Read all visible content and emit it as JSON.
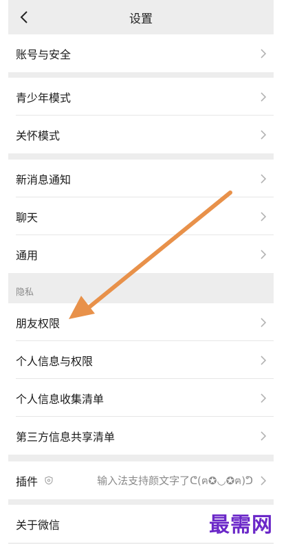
{
  "header": {
    "title": "设置",
    "back_icon": "chevron-left-icon"
  },
  "groups": [
    {
      "items": [
        {
          "label": "账号与安全"
        }
      ]
    },
    {
      "items": [
        {
          "label": "青少年模式"
        },
        {
          "label": "关怀模式"
        }
      ]
    },
    {
      "items": [
        {
          "label": "新消息通知"
        },
        {
          "label": "聊天"
        },
        {
          "label": "通用"
        }
      ]
    }
  ],
  "privacy": {
    "section_label": "隐私",
    "items": [
      {
        "label": "朋友权限"
      },
      {
        "label": "个人信息与权限"
      },
      {
        "label": "个人信息收集清单"
      },
      {
        "label": "第三方信息共享清单"
      }
    ]
  },
  "plugins": {
    "label": "插件",
    "icon": "shield-icon",
    "value": "输入法支持颜文字了ᕦ(ฅ✪◡✪ฅ)ᕤ"
  },
  "about": {
    "label": "关于微信"
  },
  "watermark": "最需网",
  "colors": {
    "background": "#ededed",
    "row": "#ffffff",
    "arrow": "#e8914a",
    "watermark": "#6b28c8"
  }
}
